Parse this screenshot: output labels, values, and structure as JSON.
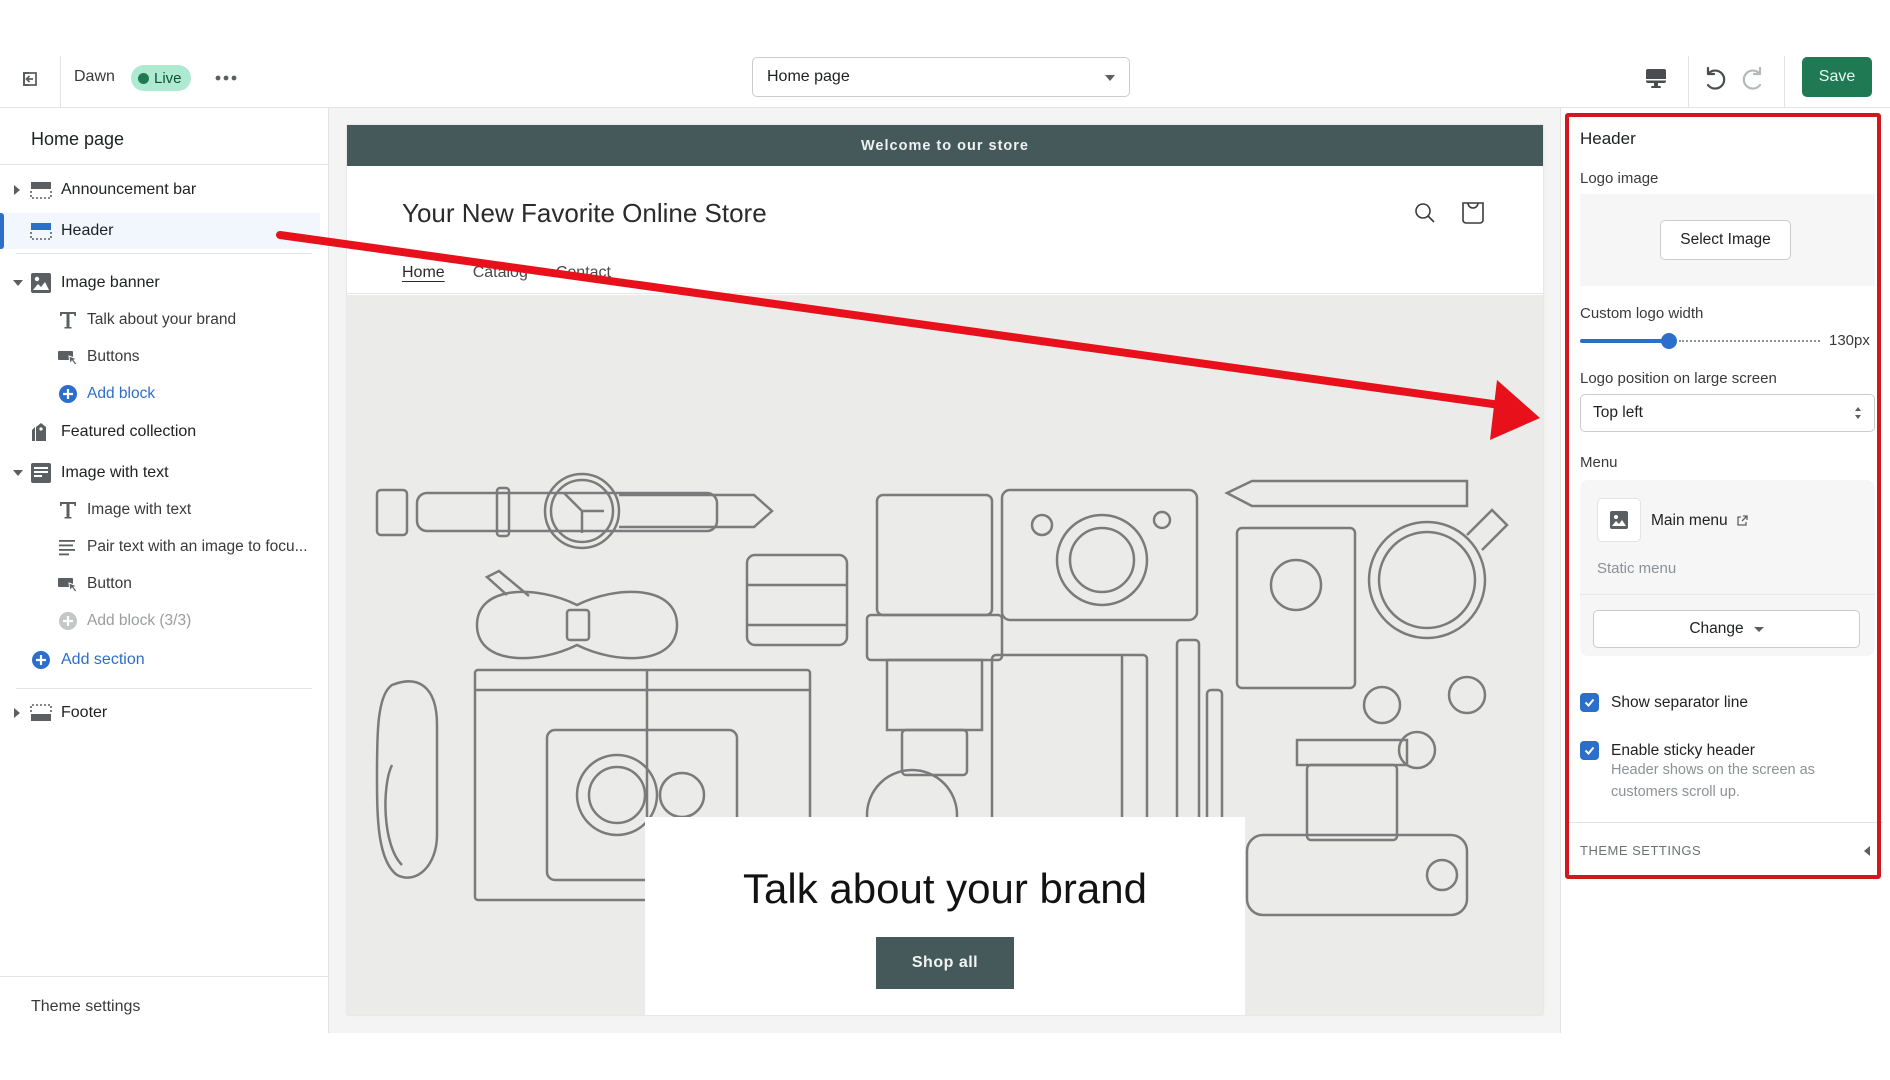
{
  "topbar": {
    "exit_icon": "exit-icon",
    "theme_name": "Dawn",
    "live_badge": "Live",
    "more_label": "•••",
    "page_select": {
      "value": "Home page"
    },
    "save_label": "Save",
    "colors": {
      "save": "#1f7a53",
      "live_badge_bg": "#aee9d1"
    }
  },
  "sidebar": {
    "title": "Home page",
    "items": [
      {
        "label": "Announcement bar",
        "icon": "announcement-bar-icon",
        "expand": "collapsed"
      },
      {
        "label": "Header",
        "icon": "header-icon",
        "selected": true
      },
      {
        "label": "Image banner",
        "icon": "image-icon",
        "expand": "expanded",
        "children": [
          {
            "label": "Talk about your brand",
            "icon": "text-icon"
          },
          {
            "label": "Buttons",
            "icon": "button-icon"
          },
          {
            "label": "Add block",
            "icon": "add-circle-icon",
            "type": "add"
          }
        ]
      },
      {
        "label": "Featured collection",
        "icon": "collection-icon"
      },
      {
        "label": "Image with text",
        "icon": "image-with-text-icon",
        "expand": "expanded",
        "children": [
          {
            "label": "Image with text",
            "icon": "text-icon"
          },
          {
            "label": "Pair text with an image to focu...",
            "icon": "paragraph-icon"
          },
          {
            "label": "Button",
            "icon": "button-icon"
          },
          {
            "label": "Add block (3/3)",
            "icon": "add-circle-icon",
            "type": "disabled"
          }
        ]
      }
    ],
    "add_section": "Add section",
    "footer": {
      "label": "Footer",
      "icon": "footer-icon",
      "expand": "collapsed"
    },
    "theme_settings": "Theme settings"
  },
  "preview": {
    "announcement": "Welcome to our store",
    "store_title": "Your New Favorite Online Store",
    "nav": [
      "Home",
      "Catalog",
      "Contact"
    ],
    "nav_active": "Home",
    "banner": {
      "heading": "Talk about your brand",
      "button": "Shop all"
    },
    "colors": {
      "accent": "#45585a",
      "banner_bg": "#ebebea"
    }
  },
  "settings": {
    "title": "Header",
    "logo_image_label": "Logo image",
    "select_image": "Select Image",
    "logo_width_label": "Custom logo width",
    "logo_width_value": "130px",
    "logo_width_fraction": 0.37,
    "logo_position_label": "Logo position on large screen",
    "logo_position_value": "Top left",
    "menu_label": "Menu",
    "menu_name": "Main menu",
    "menu_sub": "Static menu",
    "change_label": "Change",
    "show_separator": {
      "label": "Show separator line",
      "checked": true
    },
    "sticky_header": {
      "label": "Enable sticky header",
      "checked": true,
      "help": "Header shows on the screen as customers scroll up."
    },
    "theme_settings": "THEME SETTINGS",
    "colors": {
      "accent": "#2c6ecb"
    }
  },
  "annotation": {
    "color": "#d0191e",
    "type": "arrow-and-box"
  }
}
